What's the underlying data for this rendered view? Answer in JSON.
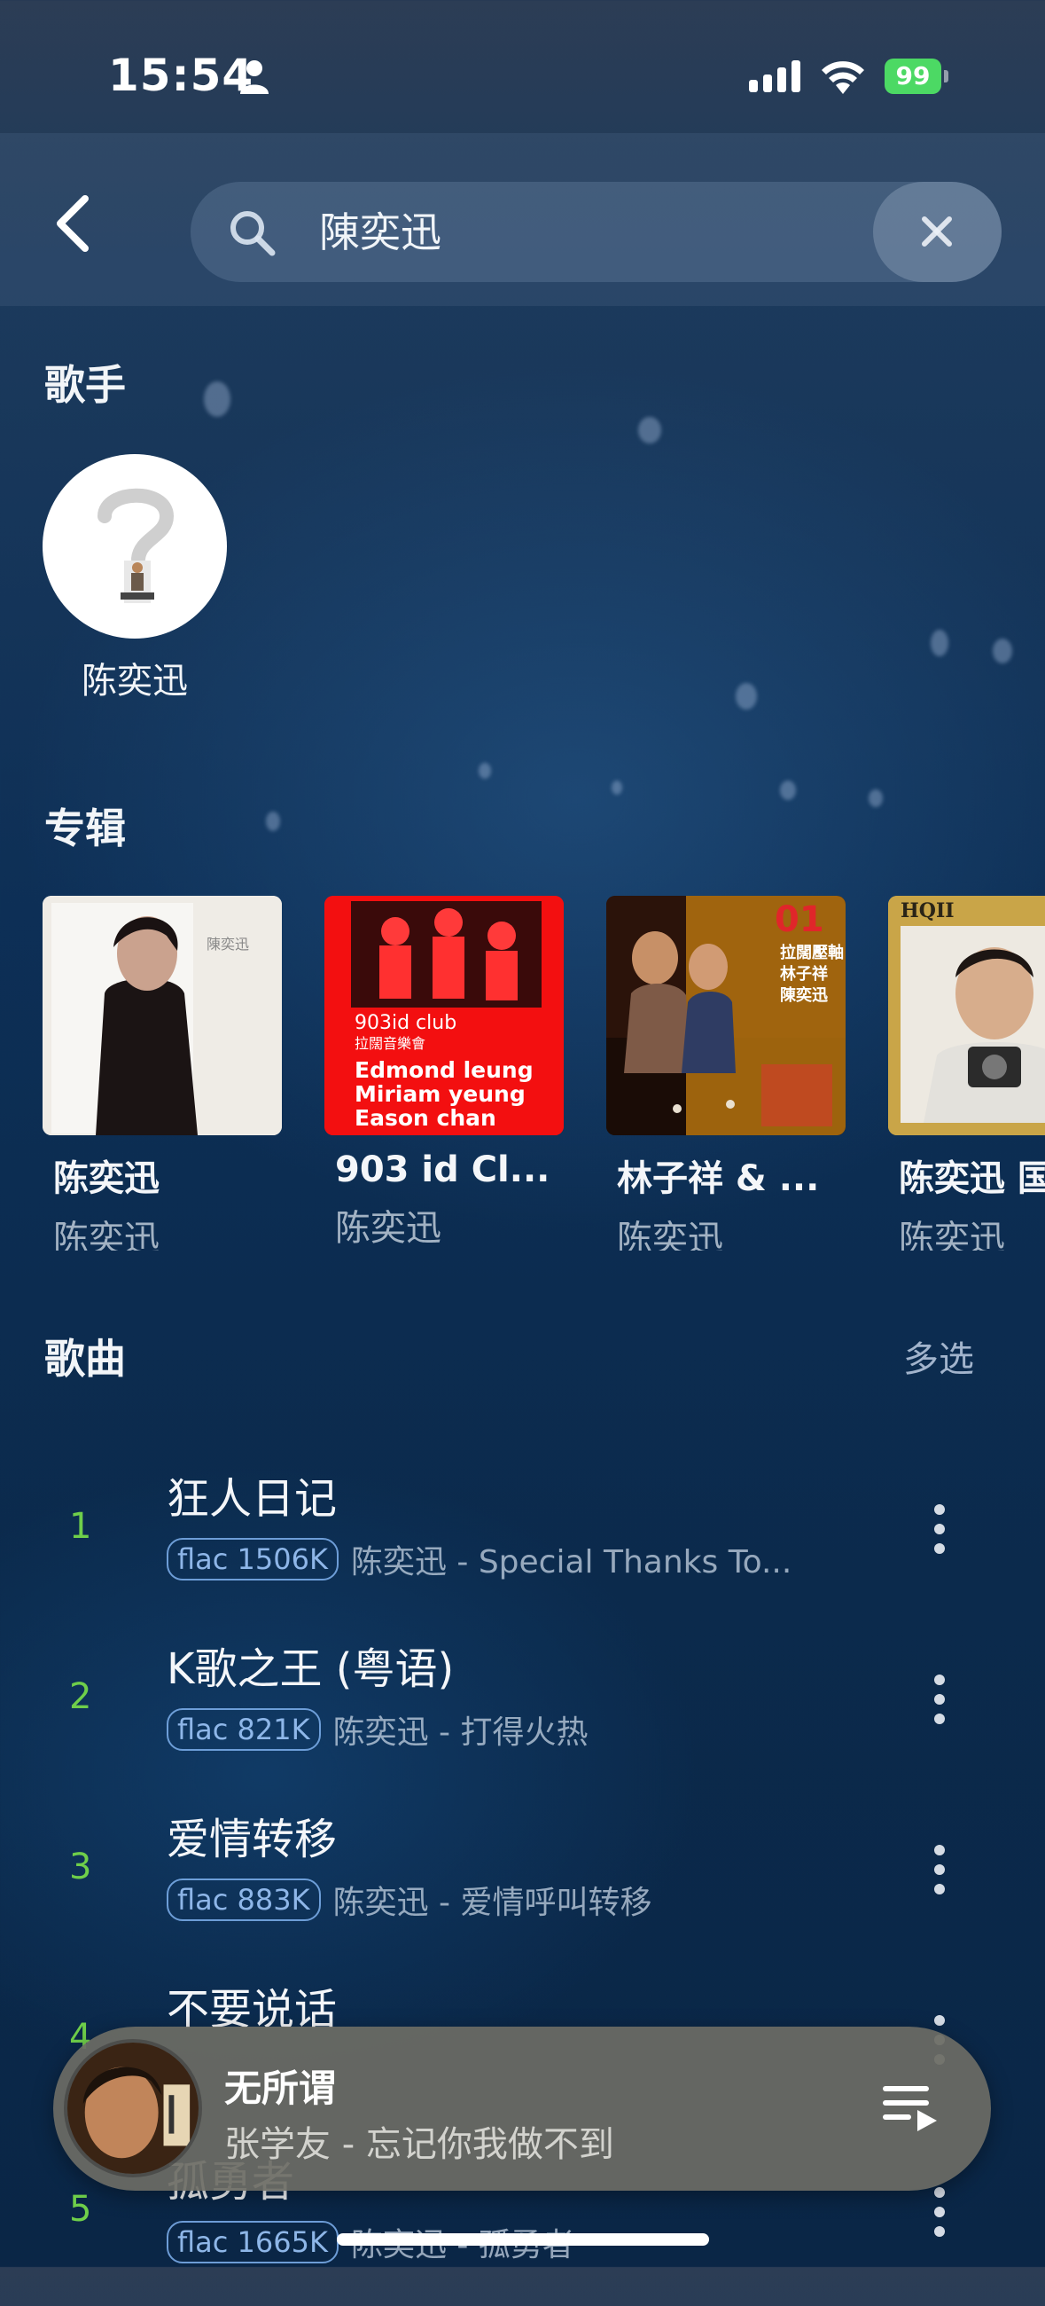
{
  "status_bar": {
    "time": "15:54",
    "battery": "99"
  },
  "search": {
    "query": "陳奕迅"
  },
  "sections": {
    "artists": "歌手",
    "albums": "专辑",
    "songs": "歌曲",
    "multi_select": "多选"
  },
  "artist": {
    "name": "陈奕迅"
  },
  "albums": [
    {
      "title": "陈奕迅",
      "artist": "陈奕迅"
    },
    {
      "title": "903 id Cl...",
      "artist": "陈奕迅"
    },
    {
      "title": "林子祥 & ...",
      "artist": "陈奕迅"
    },
    {
      "title": "陈奕迅 国",
      "artist": "陈奕迅"
    }
  ],
  "album_cover_text": {
    "a1": "陳奕迅",
    "a2_line1": "903id club",
    "a2_line2": "拉闊音樂會",
    "a2_names": [
      "Edmond leung",
      "Miriam yeung",
      "Eason chan"
    ],
    "a3_num": "01",
    "a3_lines": [
      "拉闊壓軸",
      "林子祥",
      "陳奕迅"
    ],
    "a4_top": "HQII"
  },
  "songs": [
    {
      "index": "1",
      "title": "狂人日记",
      "quality": "flac 1506K",
      "sub": "陈奕迅 - Special Thanks To..."
    },
    {
      "index": "2",
      "title": "K歌之王 (粤语)",
      "quality": "flac 821K",
      "sub": "陈奕迅 - 打得火热"
    },
    {
      "index": "3",
      "title": "爱情转移",
      "quality": "flac 883K",
      "sub": "陈奕迅 - 爱情呼叫转移"
    },
    {
      "index": "4",
      "title": "不要说话",
      "quality": "",
      "sub": ""
    },
    {
      "index": "5",
      "title": "孤勇者",
      "quality": "flac 1665K",
      "sub": "陈奕迅 - 孤勇者"
    }
  ],
  "player": {
    "title": "无所谓",
    "subtitle": "张学友 - 忘记你我做不到"
  },
  "colors": {
    "accent_index": "#6fcf4a",
    "battery": "#4cd964",
    "badge": "#78aae6"
  }
}
